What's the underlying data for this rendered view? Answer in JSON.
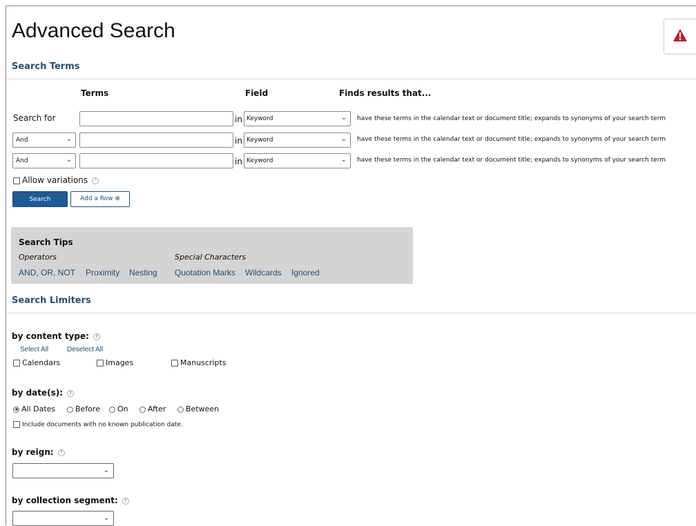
{
  "page": {
    "title": "Advanced Search"
  },
  "search_terms": {
    "heading": "Search Terms",
    "col_terms": "Terms",
    "col_field": "Field",
    "col_finds": "Finds results that...",
    "first_row_label": "Search for",
    "in_label": "in",
    "rows": [
      {
        "bool": "",
        "field": "Keyword",
        "desc": "have these terms in the calendar text or document title; expands to synonyms of your search term"
      },
      {
        "bool": "And",
        "field": "Keyword",
        "desc": "have these terms in the calendar text or document title; expands to synonyms of your search term"
      },
      {
        "bool": "And",
        "field": "Keyword",
        "desc": "have these terms in the calendar text or document title; expands to synonyms of your search term"
      }
    ],
    "allow_variations": "Allow variations",
    "search_button": "Search",
    "add_row_button": "Add a Row ⊕"
  },
  "tips": {
    "heading": "Search Tips",
    "operators_label": "Operators",
    "special_label": "Special Characters",
    "links": [
      "AND, OR, NOT",
      "Proximity",
      "Nesting",
      "Quotation Marks",
      "Wildcards",
      "Ignored"
    ]
  },
  "limiters": {
    "heading": "Search Limiters",
    "content_type_label": "by content type:",
    "select_all": "Select All",
    "deselect_all": "Deselect All",
    "content_types": [
      "Calendars",
      "Images",
      "Manuscripts"
    ],
    "dates_label": "by date(s):",
    "date_options": [
      "All Dates",
      "Before",
      "On",
      "After",
      "Between"
    ],
    "date_selected": "All Dates",
    "include_undated": "Include documents with no known publication date.",
    "reign_label": "by reign:",
    "reign_value": "",
    "segment_label": "by collection segment:",
    "segment_value": ""
  },
  "icons": {
    "alert": "warning-triangle-icon",
    "help": "question-circle-icon"
  },
  "colors": {
    "heading": "#1f4e79",
    "primary_button": "#1d5a96",
    "tips_bg": "#d4d4d4",
    "alert": "#c0172a"
  }
}
